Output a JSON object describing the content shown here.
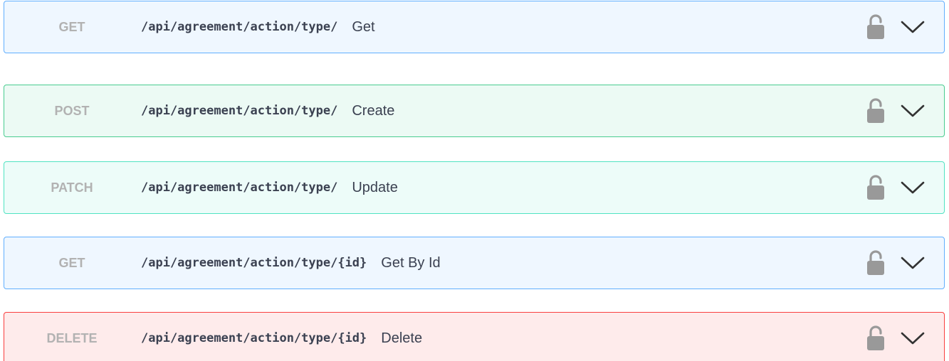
{
  "operations": [
    {
      "method": "GET",
      "method_class": "get",
      "path": "/api/agreement/action/type/",
      "summary": "Get"
    },
    {
      "method": "POST",
      "method_class": "post",
      "path": "/api/agreement/action/type/",
      "summary": "Create"
    },
    {
      "method": "PATCH",
      "method_class": "patch",
      "path": "/api/agreement/action/type/",
      "summary": "Update"
    },
    {
      "method": "GET",
      "method_class": "get",
      "path": "/api/agreement/action/type/{id}",
      "summary": "Get By Id"
    },
    {
      "method": "DELETE",
      "method_class": "delete",
      "path": "/api/agreement/action/type/{id}",
      "summary": "Delete"
    }
  ],
  "colors": {
    "get": "#61affe",
    "post": "#49cc90",
    "patch": "#50e3c2",
    "delete": "#f93e3e",
    "method_text": "#b2b2b2",
    "icon": "#999999"
  },
  "icons": {
    "lock": "unlocked-padlock-icon",
    "expand": "chevron-down-icon"
  }
}
